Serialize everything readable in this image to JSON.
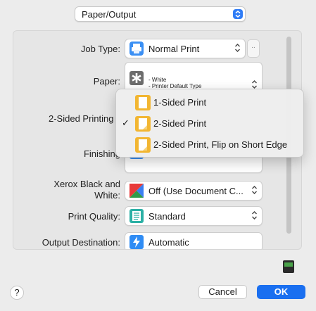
{
  "top_select": {
    "label": "Paper/Output"
  },
  "settings": {
    "job_type": {
      "label": "Job Type:",
      "value": "Normal Print",
      "more_label": ".."
    },
    "paper": {
      "label": "Paper:",
      "line1": "- White",
      "line2": "- Printer Default Type"
    },
    "two_sided": {
      "label": "2-Sided Printing"
    },
    "finishing": {
      "label": "Finishing"
    },
    "xerox_bw": {
      "label_line1": "Xerox Black and",
      "label_line2": "White:",
      "value": "Off (Use Document C..."
    },
    "print_quality": {
      "label": "Print Quality:",
      "value": "Standard"
    },
    "output_destination": {
      "label": "Output Destination:",
      "value": "Automatic"
    }
  },
  "two_sided_menu": {
    "items": [
      {
        "label": "1-Sided Print",
        "checked": false
      },
      {
        "label": "2-Sided Print",
        "checked": true,
        "check_mark": "✓"
      },
      {
        "label": "2-Sided Print, Flip on Short Edge",
        "checked": false
      }
    ]
  },
  "footer": {
    "help_label": "?",
    "cancel_label": "Cancel",
    "ok_label": "OK"
  },
  "colors": {
    "accent": "#1a6ff0",
    "doc_icon": "#f2b632"
  }
}
